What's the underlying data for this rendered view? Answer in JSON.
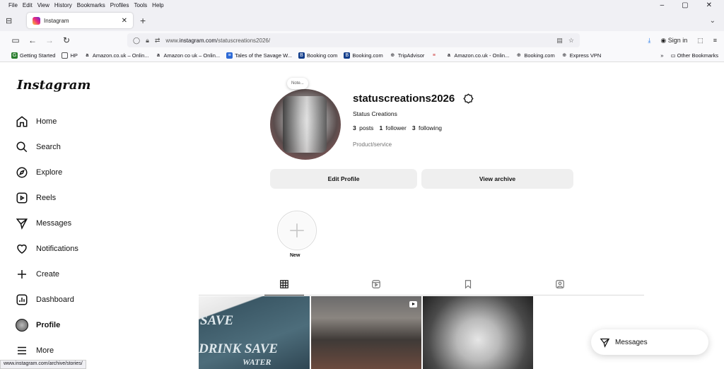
{
  "menubar": [
    "File",
    "Edit",
    "View",
    "History",
    "Bookmarks",
    "Profiles",
    "Tools",
    "Help"
  ],
  "window_controls": [
    "–",
    "▢",
    "✕"
  ],
  "tab": {
    "title": "Instagram",
    "close": "✕"
  },
  "new_tab": "+",
  "address": {
    "prefix": "www.",
    "host": "instagram.com",
    "path": "/statuscreations2026/"
  },
  "signin": "Sign in",
  "bookmarks": [
    {
      "label": "Getting Started",
      "icon": "G",
      "color": "#2a7d2e"
    },
    {
      "label": "HP",
      "icon": "▭",
      "color": "#555"
    },
    {
      "label": "Amazon.co.uk – Onlin...",
      "icon": "a",
      "color": "#111"
    },
    {
      "label": "Amazon co uk – Onlin...",
      "icon": "a",
      "color": "#111"
    },
    {
      "label": "Tales of the Savage W...",
      "icon": "≡",
      "color": "#2d6ad6"
    },
    {
      "label": "Booking com",
      "icon": "B",
      "color": "#123d8b"
    },
    {
      "label": "Booking.com",
      "icon": "B",
      "color": "#123d8b"
    },
    {
      "label": "TripAdvisor",
      "icon": "◎",
      "color": "#333"
    },
    {
      "label": "",
      "icon": "≡",
      "color": "#c33"
    },
    {
      "label": "Amazon.co.uk - Onlin...",
      "icon": "a",
      "color": "#111"
    },
    {
      "label": "Booking.com",
      "icon": "⊕",
      "color": "#333"
    },
    {
      "label": "Express VPN",
      "icon": "⊕",
      "color": "#333"
    }
  ],
  "other_bookmarks": "Other Bookmarks",
  "sidebar": {
    "logo": "Instagram",
    "items": [
      {
        "label": "Home",
        "icon": "home-icon"
      },
      {
        "label": "Search",
        "icon": "search-icon"
      },
      {
        "label": "Explore",
        "icon": "compass-icon"
      },
      {
        "label": "Reels",
        "icon": "reels-icon"
      },
      {
        "label": "Messages",
        "icon": "send-icon"
      },
      {
        "label": "Notifications",
        "icon": "heart-icon"
      },
      {
        "label": "Create",
        "icon": "plus-icon"
      },
      {
        "label": "Dashboard",
        "icon": "chart-icon"
      },
      {
        "label": "Profile",
        "icon": "avatar"
      },
      {
        "label": "More",
        "icon": "menu-icon"
      }
    ]
  },
  "profile": {
    "note": "Note...",
    "username": "statuscreations2026",
    "full_name": "Status Creations",
    "posts_count": "3",
    "posts_label": "posts",
    "followers_count": "1",
    "followers_label": "follower",
    "following_count": "3",
    "following_label": "following",
    "category": "Product/service",
    "edit_profile": "Edit Profile",
    "view_archive": "View archive",
    "highlight_new": "New"
  },
  "post_text": {
    "line1": "SAVE",
    "line2": "DRINK SAVE",
    "line3": "WATER"
  },
  "messages_button": "Messages",
  "status_url": "www.instagram.com/archive/stories/"
}
